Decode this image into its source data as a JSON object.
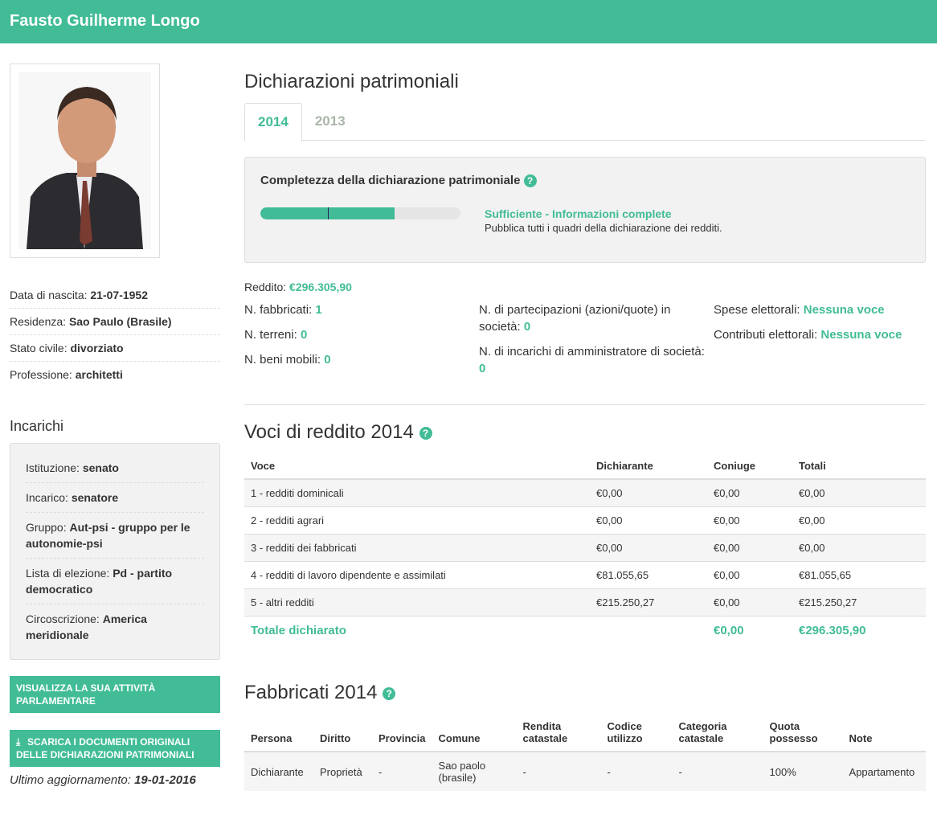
{
  "header": {
    "name": "Fausto Guilherme Longo"
  },
  "profile": {
    "fields": [
      {
        "label": "Data di nascita:",
        "value": "21-07-1952"
      },
      {
        "label": "Residenza:",
        "value": "Sao Paulo (Brasile)"
      },
      {
        "label": "Stato civile:",
        "value": "divorziato"
      },
      {
        "label": "Professione:",
        "value": "architetti"
      }
    ]
  },
  "incarichi": {
    "title": "Incarichi",
    "fields": [
      {
        "label": "Istituzione:",
        "value": "senato"
      },
      {
        "label": "Incarico:",
        "value": "senatore"
      },
      {
        "label": "Gruppo:",
        "value": "Aut-psi - gruppo per le autonomie-psi"
      },
      {
        "label": "Lista di elezione:",
        "value": "Pd - partito democratico"
      },
      {
        "label": "Circoscrizione:",
        "value": "America meridionale"
      }
    ]
  },
  "buttons": {
    "activity": "Visualizza la sua attività parlamentare",
    "download": "Scarica i documenti originali delle dichiarazioni patrimoniali"
  },
  "update": {
    "label": "Ultimo aggiornamento:",
    "date": "19-01-2016"
  },
  "main": {
    "title": "Dichiarazioni patrimoniali",
    "tabs": [
      {
        "label": "2014",
        "active": true
      },
      {
        "label": "2013",
        "active": false
      }
    ],
    "completeness": {
      "title": "Completezza della dichiarazione patrimoniale",
      "level_fraction": 0.67,
      "status": "Sufficiente - Informazioni complete",
      "description": "Pubblica tutti i quadri della dichiarazione dei redditi."
    },
    "reddito": {
      "label": "Reddito:",
      "value": "€296.305,90"
    },
    "stats_col1": [
      {
        "label": "N. fabbricati:",
        "value": "1"
      },
      {
        "label": "N. terreni:",
        "value": "0"
      },
      {
        "label": "N. beni mobili:",
        "value": "0"
      }
    ],
    "stats_col2": [
      {
        "label": "N. di partecipazioni (azioni/quote) in società:",
        "value": "0"
      },
      {
        "label": "N. di incarichi di amministratore di società:",
        "value": "0"
      }
    ],
    "stats_col3": [
      {
        "label": "Spese elettorali:",
        "value": "Nessuna voce"
      },
      {
        "label": "Contributi elettorali:",
        "value": "Nessuna voce"
      }
    ],
    "redditi": {
      "title": "Voci di reddito 2014",
      "columns": [
        "Voce",
        "Dichiarante",
        "Coniuge",
        "Totali"
      ],
      "rows": [
        [
          "1 - redditi dominicali",
          "€0,00",
          "€0,00",
          "€0,00"
        ],
        [
          "2 - redditi agrari",
          "€0,00",
          "€0,00",
          "€0,00"
        ],
        [
          "3 - redditi dei fabbricati",
          "€0,00",
          "€0,00",
          "€0,00"
        ],
        [
          "4 - redditi di lavoro dipendente e assimilati",
          "€81.055,65",
          "€0,00",
          "€81.055,65"
        ],
        [
          "5 - altri redditi",
          "€215.250,27",
          "€0,00",
          "€215.250,27"
        ]
      ],
      "total": [
        "Totale dichiarato",
        "",
        "€0,00",
        "€296.305,90"
      ]
    },
    "fabbricati": {
      "title": "Fabbricati 2014",
      "columns": [
        "Persona",
        "Diritto",
        "Provincia",
        "Comune",
        "Rendita catastale",
        "Codice utilizzo",
        "Categoria catastale",
        "Quota possesso",
        "Note"
      ],
      "rows": [
        [
          "Dichiarante",
          "Proprietà",
          "-",
          "Sao paolo (brasile)",
          "-",
          "-",
          "-",
          "100%",
          "Appartamento"
        ]
      ]
    }
  },
  "colors": {
    "accent": "#41bc97",
    "panel": "#f2f2f2"
  },
  "icons": {
    "help": "question-circle-icon",
    "download": "download-icon"
  }
}
